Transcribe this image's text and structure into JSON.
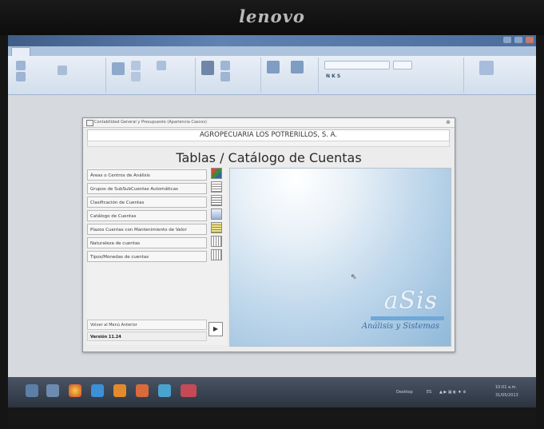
{
  "monitor": {
    "brand": "lenovo"
  },
  "dialog": {
    "window_title": "Contabilidad General y Presupuesto (Apariencia Cascos)",
    "company": "AGROPECUARIA LOS POTRERILLOS, S. A.",
    "heading": "Tablas / Catálogo de Cuentas",
    "menu_items": [
      "Áreas o Centros de Análisis",
      "Grupos de SubSubCuentas Automáticas",
      "Clasificación de Cuentas",
      "Catálogo de Cuentas",
      "Plazos Cuentas con Mantenimiento de Valor",
      "Naturaleza de cuentas",
      "Tipos/Monedas de cuentas"
    ],
    "back_label": "Volver al Menú Anterior",
    "version": "Versión 11.24",
    "logo_text": "aSis",
    "logo_subtitle": "Análisis y Sistemas"
  },
  "taskbar": {
    "desktop_label": "Desktop",
    "lang": "ES",
    "time": "10:01 a.m.",
    "date": "31/05/2013"
  }
}
